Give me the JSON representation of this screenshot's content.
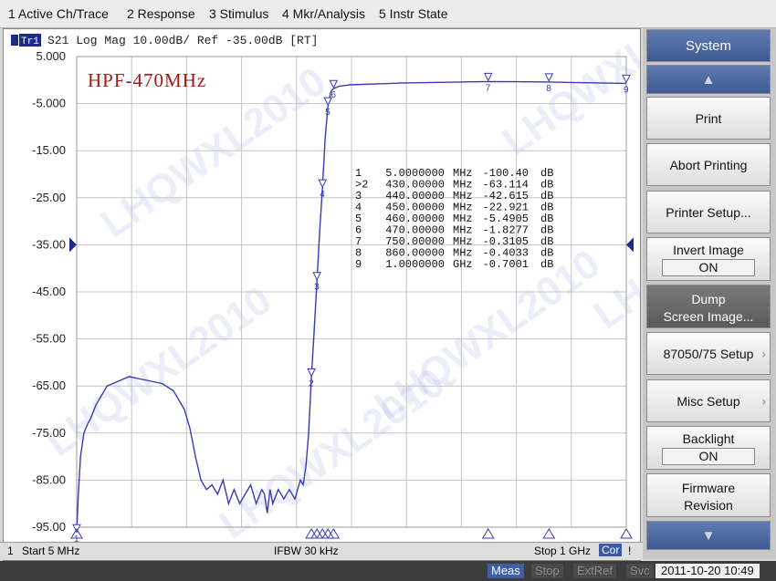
{
  "menu": [
    "1 Active Ch/Trace",
    "2 Response",
    "3 Stimulus",
    "4 Mkr/Analysis",
    "5 Instr State"
  ],
  "trace": {
    "tag": "Tr1",
    "header": "S21  Log Mag 10.00dB/  Ref -35.00dB  [RT]",
    "title": "HPF-470MHz",
    "color": "#3a3ab4"
  },
  "watermark": "LHQWXL2010",
  "chart_data": {
    "type": "line",
    "x_unit": "MHz",
    "xlim": [
      5,
      1000
    ],
    "ylim": [
      -95,
      5
    ],
    "ytick_labels": [
      "5.000",
      "-5.000",
      "-15.00",
      "-25.00",
      "-35.00",
      "-45.00",
      "-55.00",
      "-65.00",
      "-75.00",
      "-85.00",
      "-95.00"
    ],
    "ref_level": -35,
    "grid": true,
    "series": [
      {
        "x": [
          5,
          8,
          12,
          18,
          25,
          30,
          40,
          60,
          80,
          100,
          120,
          140,
          160,
          180,
          200,
          210,
          215,
          220,
          230,
          240,
          250,
          260,
          270,
          280,
          290,
          300,
          310,
          320,
          330,
          340,
          345,
          350,
          355,
          360,
          370,
          380,
          390,
          400,
          410,
          415,
          420,
          425,
          430,
          435,
          440,
          445,
          450,
          455,
          460,
          465,
          470,
          480,
          500,
          550,
          600,
          650,
          700,
          750,
          800,
          860,
          900,
          950,
          1000
        ],
        "y": [
          -100.4,
          -88,
          -80,
          -75,
          -73,
          -72,
          -69,
          -65,
          -64,
          -63,
          -63.5,
          -64,
          -64.5,
          -66,
          -70,
          -74,
          -77,
          -80,
          -85,
          -87,
          -86,
          -88,
          -85,
          -90,
          -87,
          -90,
          -88,
          -86,
          -90,
          -87,
          -88,
          -92,
          -87,
          -90,
          -87,
          -89,
          -87,
          -89,
          -85,
          -86,
          -82,
          -75,
          -63.114,
          -53,
          -42.615,
          -32,
          -22.921,
          -12,
          -5.4905,
          -2.5,
          -1.8277,
          -1.3,
          -1.0,
          -0.8,
          -0.6,
          -0.5,
          -0.4,
          -0.3105,
          -0.35,
          -0.4033,
          -0.5,
          -0.6,
          -0.7001
        ]
      }
    ]
  },
  "markers": [
    {
      "num": "1",
      "active": false,
      "freq": "5.0000000",
      "unit": "MHz",
      "value": "-100.40",
      "db": "dB",
      "x": 5,
      "y": -100.4
    },
    {
      "num": "2",
      "active": true,
      "freq": "430.00000",
      "unit": "MHz",
      "value": "-63.114",
      "db": "dB",
      "x": 430,
      "y": -63.114
    },
    {
      "num": "3",
      "active": false,
      "freq": "440.00000",
      "unit": "MHz",
      "value": "-42.615",
      "db": "dB",
      "x": 440,
      "y": -42.615
    },
    {
      "num": "4",
      "active": false,
      "freq": "450.00000",
      "unit": "MHz",
      "value": "-22.921",
      "db": "dB",
      "x": 450,
      "y": -22.921
    },
    {
      "num": "5",
      "active": false,
      "freq": "460.00000",
      "unit": "MHz",
      "value": "-5.4905",
      "db": "dB",
      "x": 460,
      "y": -5.4905
    },
    {
      "num": "6",
      "active": false,
      "freq": "470.00000",
      "unit": "MHz",
      "value": "-1.8277",
      "db": "dB",
      "x": 470,
      "y": -1.8277
    },
    {
      "num": "7",
      "active": false,
      "freq": "750.00000",
      "unit": "MHz",
      "value": "-0.3105",
      "db": "dB",
      "x": 750,
      "y": -0.3105
    },
    {
      "num": "8",
      "active": false,
      "freq": "860.00000",
      "unit": "MHz",
      "value": "-0.4033",
      "db": "dB",
      "x": 860,
      "y": -0.4033
    },
    {
      "num": "9",
      "active": false,
      "freq": "1.0000000",
      "unit": "GHz",
      "value": "-0.7001",
      "db": "dB",
      "x": 1000,
      "y": -0.7001
    }
  ],
  "status": {
    "channel": "1",
    "start": "Start 5 MHz",
    "ifbw": "IFBW 30 kHz",
    "stop": "Stop 1 GHz",
    "cor": "Cor",
    "warn": "!"
  },
  "softkeys": {
    "title": "System",
    "print": "Print",
    "abort": "Abort Printing",
    "printer_setup": "Printer Setup...",
    "invert_label": "Invert Image",
    "invert_value": "ON",
    "dump_line1": "Dump",
    "dump_line2": "Screen Image...",
    "setup_8705": "87050/75 Setup",
    "misc": "Misc Setup",
    "backlight_label": "Backlight",
    "backlight_value": "ON",
    "firmware_line1": "Firmware",
    "firmware_line2": "Revision"
  },
  "bottom": {
    "meas": "Meas",
    "stop": "Stop",
    "extref": "ExtRef",
    "svc": "Svc",
    "datetime": "2011-10-20 10:49"
  },
  "colors": {
    "trace": "#3a3ab4",
    "title": "#a01818",
    "ref_marker": "#1c2a8c",
    "panel_blue": "#4a66a0"
  }
}
